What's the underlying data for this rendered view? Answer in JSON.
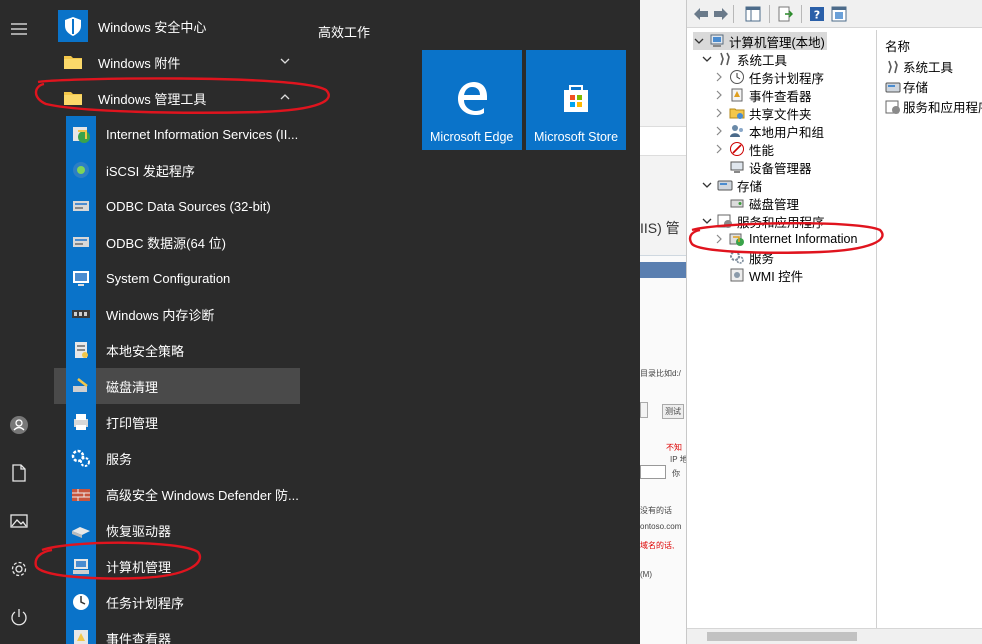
{
  "start_menu": {
    "tiles_header": "高效工作",
    "apps": [
      {
        "label": "Windows 安全中心",
        "kind": "folder-security"
      },
      {
        "label": "Windows 附件",
        "kind": "folder",
        "chevron": "down"
      },
      {
        "label": "Windows 管理工具",
        "kind": "folder",
        "chevron": "up"
      },
      {
        "label": "Internet Information Services (II...",
        "kind": "iis"
      },
      {
        "label": "iSCSI 发起程序",
        "kind": "iscsi"
      },
      {
        "label": "ODBC Data Sources (32-bit)",
        "kind": "odbc"
      },
      {
        "label": "ODBC 数据源(64 位)",
        "kind": "odbc"
      },
      {
        "label": "System Configuration",
        "kind": "sysconfig"
      },
      {
        "label": "Windows 内存诊断",
        "kind": "memdiag"
      },
      {
        "label": "本地安全策略",
        "kind": "secpol"
      },
      {
        "label": "磁盘清理",
        "kind": "cleanup"
      },
      {
        "label": "打印管理",
        "kind": "print"
      },
      {
        "label": "服务",
        "kind": "services"
      },
      {
        "label": "高级安全 Windows Defender 防...",
        "kind": "firewall"
      },
      {
        "label": "恢复驱动器",
        "kind": "recovery"
      },
      {
        "label": "计算机管理",
        "kind": "compmgmt"
      },
      {
        "label": "任务计划程序",
        "kind": "tasksched"
      },
      {
        "label": "事件查看器",
        "kind": "eventvwr"
      }
    ],
    "tiles": [
      {
        "label": "Microsoft Edge",
        "icon": "edge-icon"
      },
      {
        "label": "Microsoft Store",
        "icon": "store-icon"
      }
    ],
    "rail_icons": [
      "hamburger-menu-icon",
      "user-icon",
      "document-icon",
      "pictures-icon",
      "settings-gear-icon",
      "power-icon"
    ]
  },
  "background_fragments": {
    "iis_text": "IIS) 管",
    "path_text": "目录比如d:/",
    "test_btn": "测试",
    "warn1": "不知",
    "ip_text": "IP 地",
    "dropdown_text": "你",
    "note1": "没有的话",
    "domain_text": "ontoso.com",
    "warn2": "域名的话,",
    "menu_text": "(M)"
  },
  "computer_management": {
    "tree": [
      {
        "label": "计算机管理(本地)",
        "level": 0,
        "expander": "down",
        "icon": "computer-management-icon",
        "selected": true
      },
      {
        "label": "系统工具",
        "level": 1,
        "expander": "down",
        "icon": "system-tools-icon"
      },
      {
        "label": "任务计划程序",
        "level": 2,
        "expander": "right",
        "icon": "task-scheduler-icon"
      },
      {
        "label": "事件查看器",
        "level": 2,
        "expander": "right",
        "icon": "event-viewer-icon"
      },
      {
        "label": "共享文件夹",
        "level": 2,
        "expander": "right",
        "icon": "shared-folders-icon"
      },
      {
        "label": "本地用户和组",
        "level": 2,
        "expander": "right",
        "icon": "local-users-icon"
      },
      {
        "label": "性能",
        "level": 2,
        "expander": "right",
        "icon": "performance-icon"
      },
      {
        "label": "设备管理器",
        "level": 2,
        "expander": "none",
        "icon": "device-manager-icon"
      },
      {
        "label": "存储",
        "level": 1,
        "expander": "down",
        "icon": "storage-icon"
      },
      {
        "label": "磁盘管理",
        "level": 2,
        "expander": "none",
        "icon": "disk-management-icon"
      },
      {
        "label": "服务和应用程序",
        "level": 1,
        "expander": "down",
        "icon": "services-apps-icon"
      },
      {
        "label": "Internet Information",
        "level": 2,
        "expander": "right",
        "icon": "iis-icon"
      },
      {
        "label": "服务",
        "level": 2,
        "expander": "none",
        "icon": "services-icon"
      },
      {
        "label": "WMI 控件",
        "level": 2,
        "expander": "none",
        "icon": "wmi-icon"
      }
    ],
    "right_pane": {
      "header": "名称",
      "items": [
        "系统工具",
        "存储",
        "服务和应用程序"
      ]
    }
  },
  "colors": {
    "accent": "#0a73c9",
    "menu_bg": "#2b2b2b",
    "annotation": "#e0141e"
  }
}
